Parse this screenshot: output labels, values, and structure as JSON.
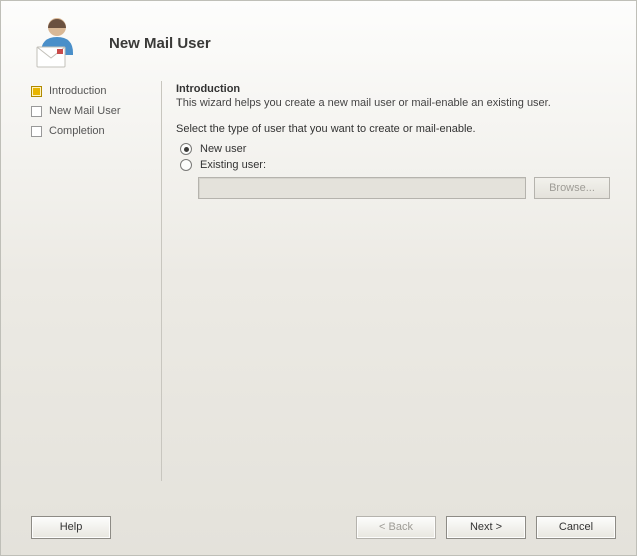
{
  "header": {
    "title": "New Mail User"
  },
  "steps": [
    {
      "label": "Introduction",
      "current": true
    },
    {
      "label": "New Mail User",
      "current": false
    },
    {
      "label": "Completion",
      "current": false
    }
  ],
  "content": {
    "section_title": "Introduction",
    "description": "This wizard helps you create a new mail user or mail-enable an existing user.",
    "instruction": "Select the type of user that you want to create or mail-enable.",
    "options": {
      "new_user": "New user",
      "existing_user": "Existing user:"
    },
    "existing_user_value": "",
    "browse_label": "Browse..."
  },
  "footer": {
    "help": "Help",
    "back": "< Back",
    "next": "Next >",
    "cancel": "Cancel"
  }
}
